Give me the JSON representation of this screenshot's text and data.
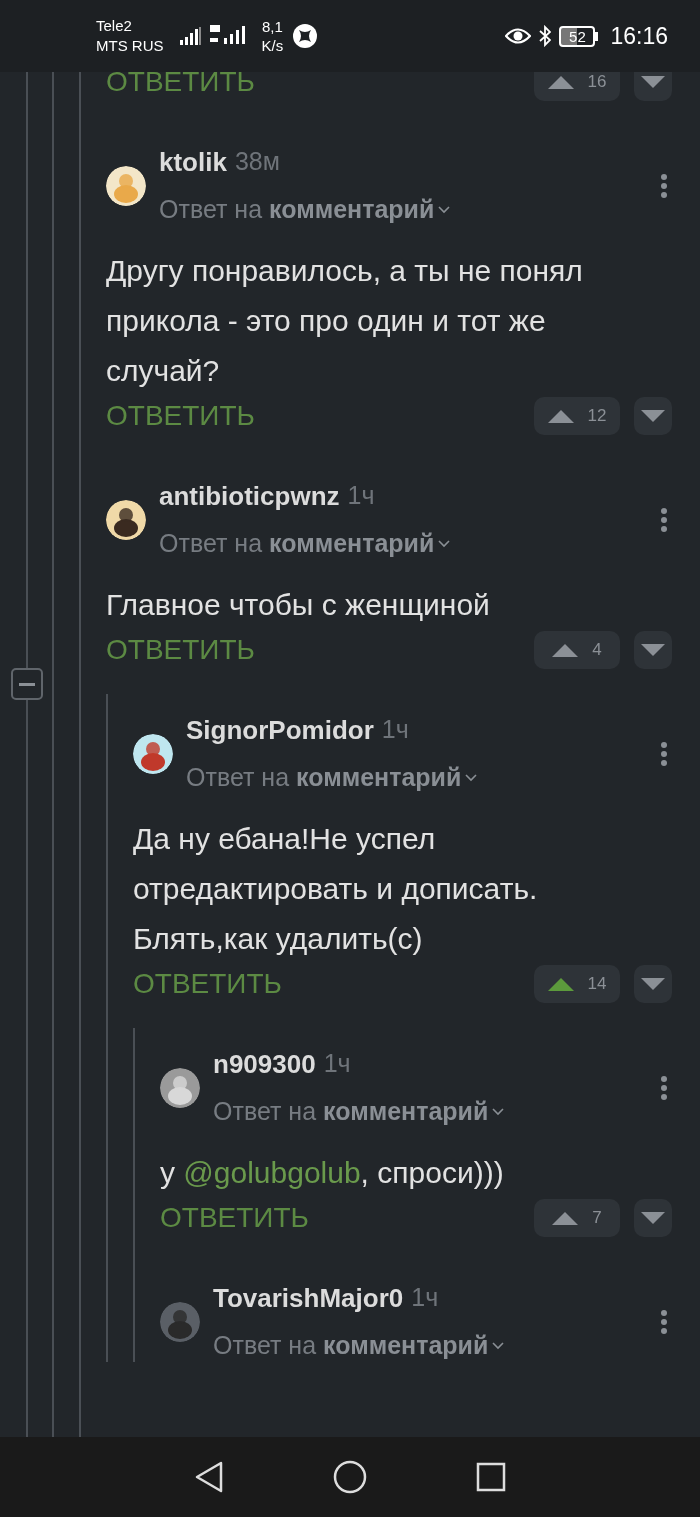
{
  "status_bar": {
    "carriers": [
      "Tele2",
      "MTS RUS"
    ],
    "speed": [
      "8,1",
      "K/s"
    ],
    "battery": "52",
    "time": "16:16"
  },
  "previous_actions": {
    "reply": "ОТВЕТИТЬ",
    "votes": "16",
    "voted": false
  },
  "comments": [
    {
      "author": "ktolik",
      "time": "38м",
      "reply_to": {
        "prefix": "Ответ на",
        "target": "комментарий"
      },
      "body": [
        {
          "kind": "text",
          "text": "Другу понравилось, а ты не понял прикола - это про один и тот же случай?"
        }
      ],
      "reply": "ОТВЕТИТЬ",
      "votes": "12",
      "voted": false
    },
    {
      "author": "antibioticpwnz",
      "time": "1ч",
      "reply_to": {
        "prefix": "Ответ на",
        "target": "комментарий"
      },
      "body": [
        {
          "kind": "text",
          "text": "Главное чтобы с женщиной"
        }
      ],
      "reply": "ОТВЕТИТЬ",
      "votes": "4",
      "voted": false,
      "children": [
        {
          "author": "SignorPomidor",
          "time": "1ч",
          "reply_to": {
            "prefix": "Ответ на",
            "target": "комментарий"
          },
          "body": [
            {
              "kind": "text",
              "text": "Да ну ебана!Не успел отредактировать и дописать. Блять,как удалить(с)"
            }
          ],
          "reply": "ОТВЕТИТЬ",
          "votes": "14",
          "voted": true,
          "children": [
            {
              "author": "n909300",
              "time": "1ч",
              "reply_to": {
                "prefix": "Ответ на",
                "target": "комментарий"
              },
              "body": [
                {
                  "kind": "text",
                  "text": "у "
                },
                {
                  "kind": "mention",
                  "text": "@golubgolub"
                },
                {
                  "kind": "text",
                  "text": ", спроси)))"
                }
              ],
              "reply": "ОТВЕТИТЬ",
              "votes": "7",
              "voted": false
            },
            {
              "author": "TovarishMajor0",
              "time": "1ч",
              "reply_to": {
                "prefix": "Ответ на",
                "target": "комментарий"
              }
            }
          ]
        }
      ]
    }
  ]
}
